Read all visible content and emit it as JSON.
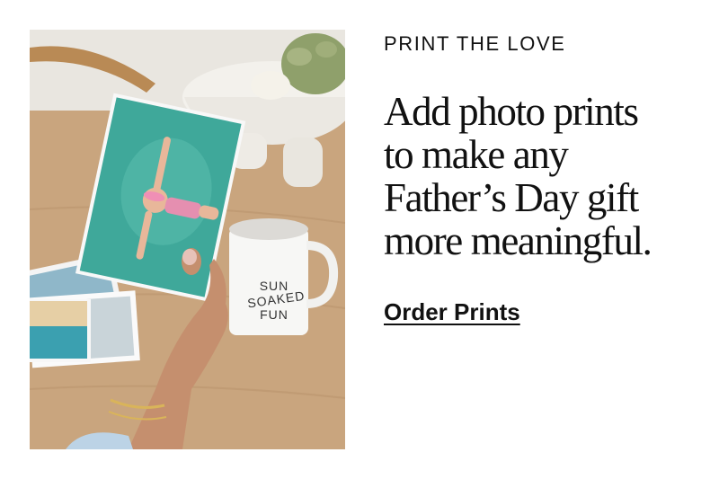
{
  "promo": {
    "eyebrow": "PRINT THE LOVE",
    "headline_lines": [
      "Add photo prints",
      "to make any",
      "Father’s Day gift",
      "more meaningful."
    ],
    "cta_label": "Order Prints"
  },
  "photo": {
    "mug_text": [
      "SUN",
      "SOAKED",
      "FUN"
    ]
  },
  "colors": {
    "text": "#111111",
    "background": "#ffffff",
    "table_wood": "#c9a57e",
    "pool_water": "#3fa89a"
  }
}
